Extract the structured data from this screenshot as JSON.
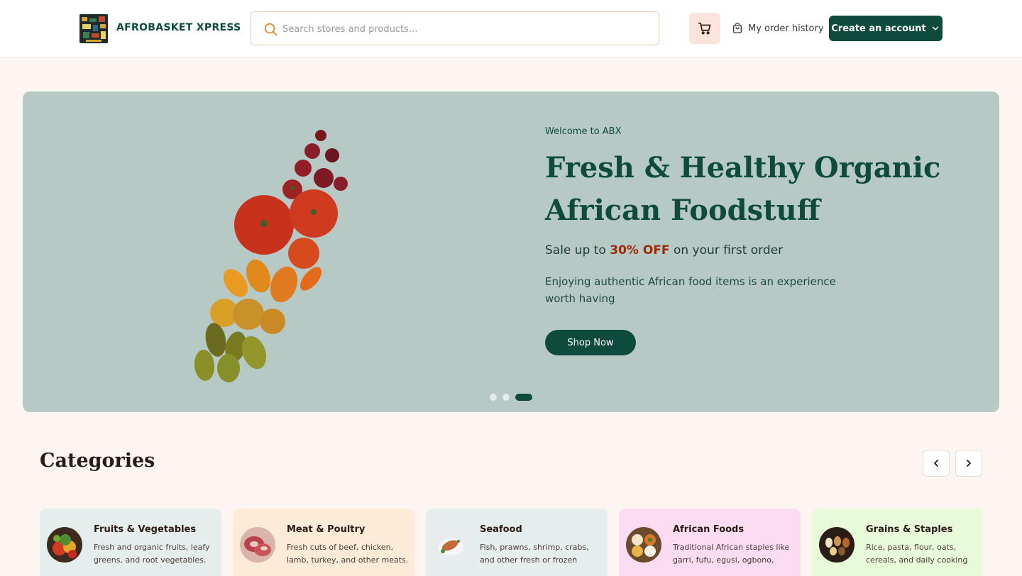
{
  "header": {
    "brand": "AFROBASKET XPRESS",
    "search_placeholder": "Search stores and products...",
    "order_history_label": "My order history",
    "account_label": "Create an account"
  },
  "hero": {
    "eyebrow": "Welcome to ABX",
    "title": "Fresh & Healthy Organic African Foodstuff",
    "sale_prefix": "Sale up to",
    "sale_highlight": "30% OFF",
    "sale_suffix": "on your first order",
    "description": "Enjoying authentic African food items is an experience worth having",
    "cta_label": "Shop Now",
    "slides_total": 3,
    "active_slide": 3
  },
  "categories": {
    "title": "Categories",
    "items": [
      {
        "name": "Fruits & Vegetables",
        "description": "Fresh and organic fruits, leafy greens, and root vegetables.",
        "bg": "#e6eded",
        "icon": "vegetables-icon"
      },
      {
        "name": "Meat & Poultry",
        "description": "Fresh cuts of beef, chicken, lamb, turkey, and other meats.",
        "bg": "#fdebd8",
        "icon": "meat-icon"
      },
      {
        "name": "Seafood",
        "description": "Fish, prawns, shrimp, crabs, and other fresh or frozen seafood.",
        "bg": "#e6eded",
        "icon": "seafood-icon"
      },
      {
        "name": "African Foods",
        "description": "Traditional African staples like garri, fufu, egusi, ogbono, and...",
        "bg": "#fbdcf1",
        "icon": "african-foods-icon"
      },
      {
        "name": "Grains & Staples",
        "description": "Rice, pasta, flour, oats, cereals, and daily cooking staples.",
        "bg": "#e7fbd9",
        "icon": "grains-icon"
      }
    ]
  },
  "colors": {
    "brand_green": "#0e4b3c",
    "accent_red": "#9c2a06",
    "hero_bg": "#b6c9c5",
    "page_bg": "#fdf5f1"
  }
}
